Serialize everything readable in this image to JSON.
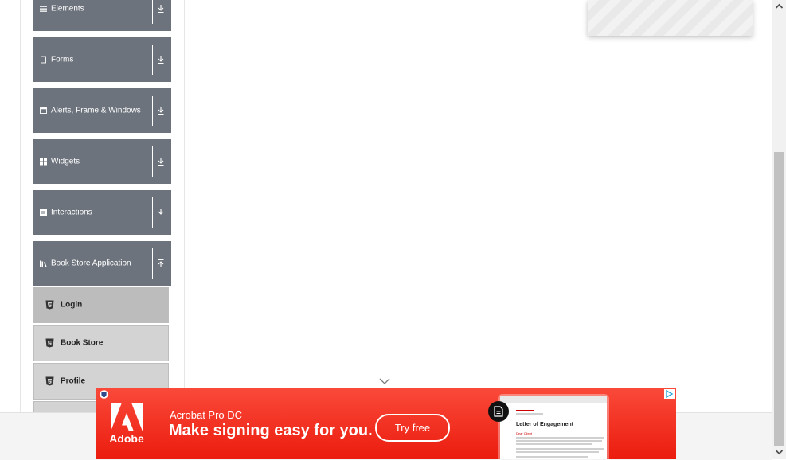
{
  "sidebar": {
    "groups": [
      {
        "label": "Elements",
        "icon": "list-icon"
      },
      {
        "label": "Forms",
        "icon": "form-icon"
      },
      {
        "label": "Alerts, Frame & Windows",
        "icon": "window-icon"
      },
      {
        "label": "Widgets",
        "icon": "widgets-icon"
      },
      {
        "label": "Interactions",
        "icon": "interactions-icon"
      },
      {
        "label": "Book Store Application",
        "icon": "book-icon",
        "expanded": true
      }
    ],
    "book_store_items": [
      {
        "label": "Login",
        "icon": "html5-icon",
        "active": true
      },
      {
        "label": "Book Store",
        "icon": "html5-icon"
      },
      {
        "label": "Profile",
        "icon": "html5-icon"
      }
    ]
  },
  "banner": {
    "brand": "Adobe",
    "product": "Acrobat Pro DC",
    "headline": "Make signing easy for you.",
    "cta": "Try free",
    "doc_title": "Letter of Engagement",
    "doc_greeting": "Dear Client",
    "accent_color": "#eb1c0e"
  },
  "colors": {
    "sidebar_header": "#6c737c",
    "sub_item": "#d3d3d3",
    "sub_item_active": "#bcbcbc"
  }
}
